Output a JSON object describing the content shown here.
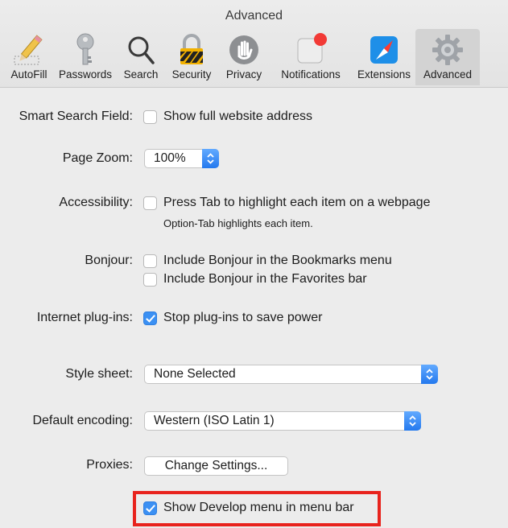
{
  "window": {
    "title": "Advanced"
  },
  "toolbar": {
    "tabs": [
      {
        "label": "AutoFill",
        "icon": "pencil-icon"
      },
      {
        "label": "Passwords",
        "icon": "key-icon"
      },
      {
        "label": "Search",
        "icon": "magnifier-icon"
      },
      {
        "label": "Security",
        "icon": "padlock-icon"
      },
      {
        "label": "Privacy",
        "icon": "hand-icon"
      },
      {
        "label": "Notifications",
        "icon": "notification-icon"
      },
      {
        "label": "Extensions",
        "icon": "compass-icon"
      },
      {
        "label": "Advanced",
        "icon": "gear-icon",
        "selected": true
      }
    ]
  },
  "settings": {
    "smart_search": {
      "label": "Smart Search Field:",
      "option": "Show full website address",
      "checked": false
    },
    "page_zoom": {
      "label": "Page Zoom:",
      "value": "100%"
    },
    "accessibility": {
      "label": "Accessibility:",
      "option": "Press Tab to highlight each item on a webpage",
      "note": "Option-Tab highlights each item.",
      "checked": false
    },
    "bonjour": {
      "label": "Bonjour:",
      "options": [
        {
          "text": "Include Bonjour in the Bookmarks menu",
          "checked": false
        },
        {
          "text": "Include Bonjour in the Favorites bar",
          "checked": false
        }
      ]
    },
    "plugins": {
      "label": "Internet plug-ins:",
      "option": "Stop plug-ins to save power",
      "checked": true
    },
    "style_sheet": {
      "label": "Style sheet:",
      "value": "None Selected"
    },
    "encoding": {
      "label": "Default encoding:",
      "value": "Western (ISO Latin 1)"
    },
    "proxies": {
      "label": "Proxies:",
      "button": "Change Settings..."
    },
    "develop_menu": {
      "option": "Show Develop menu in menu bar",
      "checked": true
    }
  },
  "colors": {
    "accent": "#3b90f3",
    "highlight": "#e8231d"
  }
}
